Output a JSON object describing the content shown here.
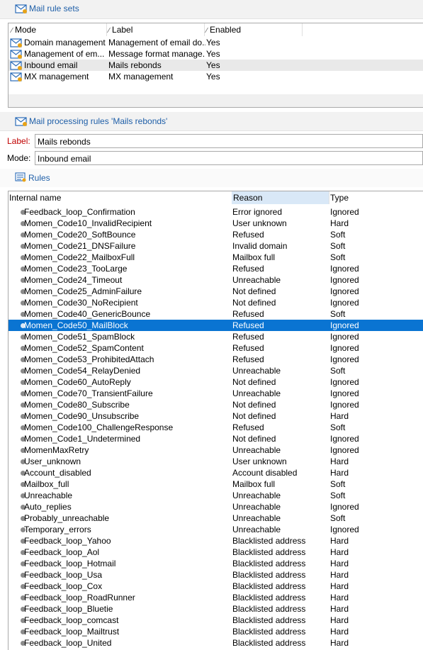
{
  "ruleSets": {
    "title": "Mail rule sets",
    "columns": {
      "mode": "Mode",
      "label": "Label",
      "enabled": "Enabled"
    },
    "rows": [
      {
        "mode": "Domain management",
        "label": "Management of email do...",
        "enabled": "Yes"
      },
      {
        "mode": "Management of em...",
        "label": "Message format manage...",
        "enabled": "Yes"
      },
      {
        "mode": "Inbound email",
        "label": "Mails rebonds",
        "enabled": "Yes"
      },
      {
        "mode": "MX management",
        "label": "MX management",
        "enabled": "Yes"
      }
    ]
  },
  "processing": {
    "title": "Mail processing rules 'Mails rebonds'",
    "labelField": {
      "label": "Label:",
      "value": "Mails rebonds"
    },
    "modeField": {
      "label": "Mode:",
      "value": "Inbound email"
    }
  },
  "rules": {
    "title": "Rules",
    "columns": {
      "name": "Internal name",
      "reason": "Reason",
      "type": "Type"
    },
    "rows": [
      {
        "name": "Feedback_loop_Confirmation",
        "reason": "Error ignored",
        "type": "Ignored"
      },
      {
        "name": "Momen_Code10_InvalidRecipient",
        "reason": "User unknown",
        "type": "Hard"
      },
      {
        "name": "Momen_Code20_SoftBounce",
        "reason": "Refused",
        "type": "Soft"
      },
      {
        "name": "Momen_Code21_DNSFailure",
        "reason": "Invalid domain",
        "type": "Soft"
      },
      {
        "name": "Momen_Code22_MailboxFull",
        "reason": "Mailbox full",
        "type": "Soft"
      },
      {
        "name": "Momen_Code23_TooLarge",
        "reason": "Refused",
        "type": "Ignored"
      },
      {
        "name": "Momen_Code24_Timeout",
        "reason": "Unreachable",
        "type": "Ignored"
      },
      {
        "name": "Momen_Code25_AdminFailure",
        "reason": "Not defined",
        "type": "Ignored"
      },
      {
        "name": "Momen_Code30_NoRecipient",
        "reason": "Not defined",
        "type": "Ignored"
      },
      {
        "name": "Momen_Code40_GenericBounce",
        "reason": "Refused",
        "type": "Soft"
      },
      {
        "name": "Momen_Code50_MailBlock",
        "reason": "Refused",
        "type": "Ignored"
      },
      {
        "name": "Momen_Code51_SpamBlock",
        "reason": "Refused",
        "type": "Ignored"
      },
      {
        "name": "Momen_Code52_SpamContent",
        "reason": "Refused",
        "type": "Ignored"
      },
      {
        "name": "Momen_Code53_ProhibitedAttach",
        "reason": "Refused",
        "type": "Ignored"
      },
      {
        "name": "Momen_Code54_RelayDenied",
        "reason": "Unreachable",
        "type": "Soft"
      },
      {
        "name": "Momen_Code60_AutoReply",
        "reason": "Not defined",
        "type": "Ignored"
      },
      {
        "name": "Momen_Code70_TransientFailure",
        "reason": "Unreachable",
        "type": "Ignored"
      },
      {
        "name": "Momen_Code80_Subscribe",
        "reason": "Not defined",
        "type": "Ignored"
      },
      {
        "name": "Momen_Code90_Unsubscribe",
        "reason": "Not defined",
        "type": "Hard"
      },
      {
        "name": "Momen_Code100_ChallengeResponse",
        "reason": "Refused",
        "type": "Soft"
      },
      {
        "name": "Momen_Code1_Undetermined",
        "reason": "Not defined",
        "type": "Ignored"
      },
      {
        "name": "MomenMaxRetry",
        "reason": "Unreachable",
        "type": "Ignored"
      },
      {
        "name": "User_unknown",
        "reason": "User unknown",
        "type": "Hard"
      },
      {
        "name": "Account_disabled",
        "reason": "Account disabled",
        "type": "Hard"
      },
      {
        "name": "Mailbox_full",
        "reason": "Mailbox full",
        "type": "Soft"
      },
      {
        "name": "Unreachable",
        "reason": "Unreachable",
        "type": "Soft"
      },
      {
        "name": "Auto_replies",
        "reason": "Unreachable",
        "type": "Ignored"
      },
      {
        "name": "Probably_unreachable",
        "reason": "Unreachable",
        "type": "Soft"
      },
      {
        "name": "Temporary_errors",
        "reason": "Unreachable",
        "type": "Ignored"
      },
      {
        "name": "Feedback_loop_Yahoo",
        "reason": "Blacklisted address",
        "type": "Hard"
      },
      {
        "name": "Feedback_loop_Aol",
        "reason": "Blacklisted address",
        "type": "Hard"
      },
      {
        "name": "Feedback_loop_Hotmail",
        "reason": "Blacklisted address",
        "type": "Hard"
      },
      {
        "name": "Feedback_loop_Usa",
        "reason": "Blacklisted address",
        "type": "Hard"
      },
      {
        "name": "Feedback_loop_Cox",
        "reason": "Blacklisted address",
        "type": "Hard"
      },
      {
        "name": "Feedback_loop_RoadRunner",
        "reason": "Blacklisted address",
        "type": "Hard"
      },
      {
        "name": "Feedback_loop_Bluetie",
        "reason": "Blacklisted address",
        "type": "Hard"
      },
      {
        "name": "Feedback_loop_comcast",
        "reason": "Blacklisted address",
        "type": "Hard"
      },
      {
        "name": "Feedback_loop_Mailtrust",
        "reason": "Blacklisted address",
        "type": "Hard"
      },
      {
        "name": "Feedback_loop_United",
        "reason": "Blacklisted address",
        "type": "Hard"
      }
    ]
  },
  "colors": {
    "titleBlue": "#1f5fa8",
    "selectionBlue": "#0a74d2",
    "labelRed": "#c00000",
    "sortedHeader": "#d9e8f7"
  }
}
